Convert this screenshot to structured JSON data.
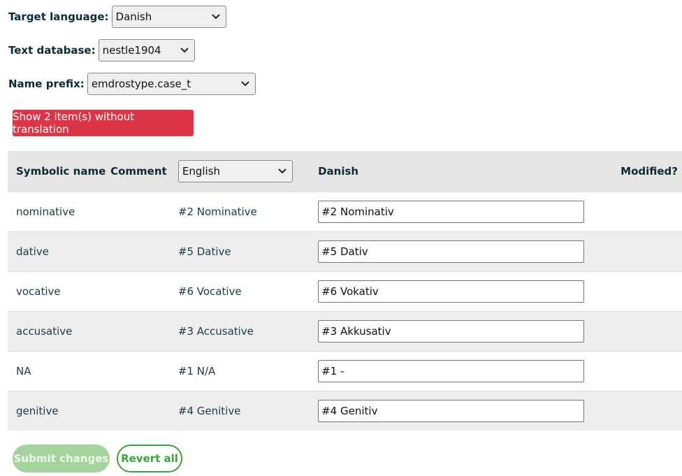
{
  "controls": {
    "target_language": {
      "label": "Target language:",
      "value": "Danish"
    },
    "text_database": {
      "label": "Text database:",
      "value": "nestle1904"
    },
    "name_prefix": {
      "label": "Name prefix:",
      "value": "emdrostype.case_t"
    }
  },
  "untranslated_button": "Show 2 item(s) without translation",
  "table": {
    "headers": {
      "symbolic_name": "Symbolic name",
      "comment": "Comment",
      "source_language": "English",
      "target_language": "Danish",
      "modified": "Modified?"
    },
    "rows": [
      {
        "symbolic": "nominative",
        "comment": "",
        "source": "#2 Nominative",
        "target": "#2 Nominativ"
      },
      {
        "symbolic": "dative",
        "comment": "",
        "source": "#5 Dative",
        "target": "#5 Dativ"
      },
      {
        "symbolic": "vocative",
        "comment": "",
        "source": "#6 Vocative",
        "target": "#6 Vokativ"
      },
      {
        "symbolic": "accusative",
        "comment": "",
        "source": "#3 Accusative",
        "target": "#3 Akkusativ"
      },
      {
        "symbolic": "NA",
        "comment": "",
        "source": "#1 N/A",
        "target": "#1 -"
      },
      {
        "symbolic": "genitive",
        "comment": "",
        "source": "#4 Genitive",
        "target": "#4 Genitiv"
      }
    ]
  },
  "actions": {
    "submit": "Submit changes",
    "revert": "Revert all"
  },
  "colors": {
    "danger": "#dc3545",
    "success": "#3aa43a",
    "success_disabled": "#a4d39b"
  }
}
